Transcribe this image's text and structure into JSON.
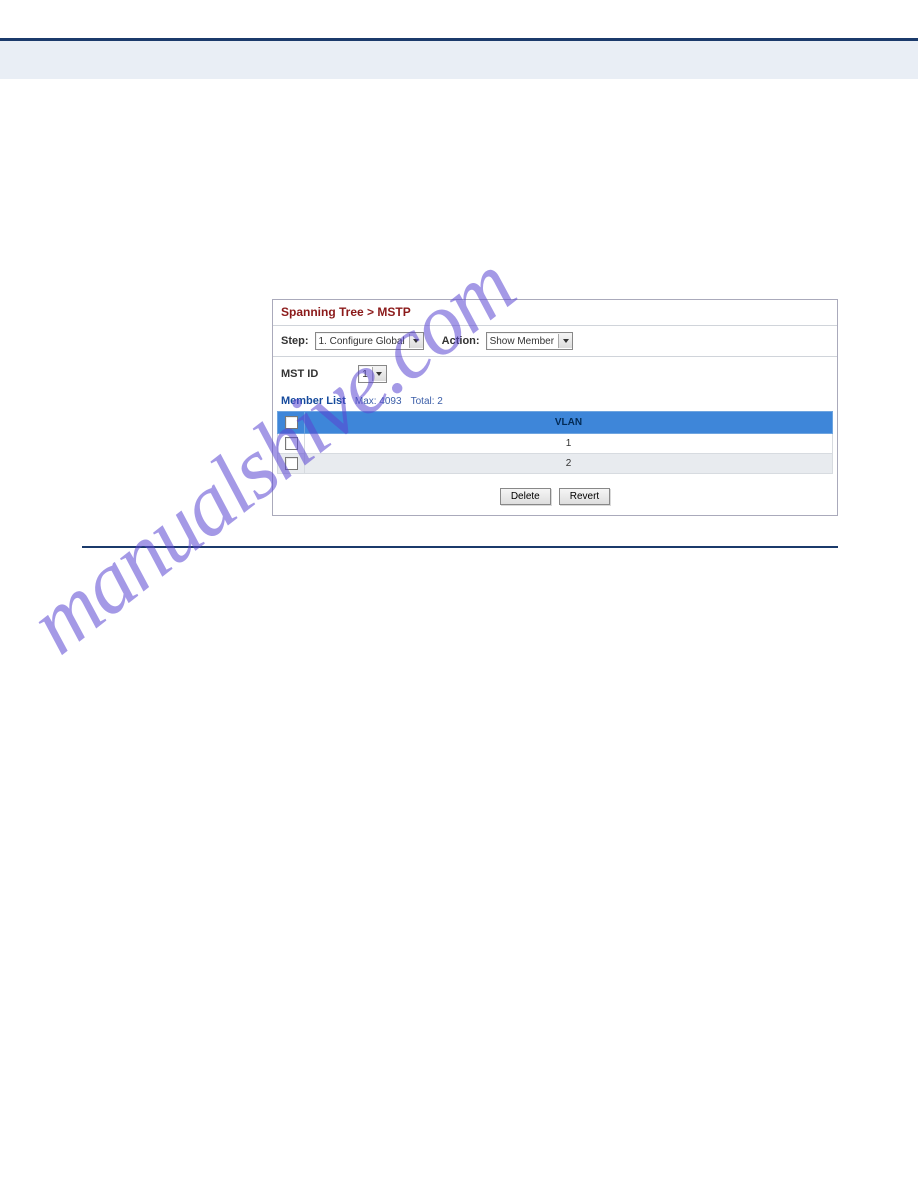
{
  "watermark": "manualshive.com",
  "panel": {
    "breadcrumb": "Spanning Tree > MSTP",
    "step_label": "Step:",
    "step_value": "1. Configure Global",
    "action_label": "Action:",
    "action_value": "Show Member",
    "mst_label": "MST ID",
    "mst_value": "1",
    "member_list_title": "Member List",
    "member_list_max": "Max: 4093",
    "member_list_total": "Total: 2",
    "table": {
      "header_vlan": "VLAN",
      "rows": [
        {
          "vlan": "1"
        },
        {
          "vlan": "2"
        }
      ]
    },
    "delete_button": "Delete",
    "revert_button": "Revert"
  }
}
